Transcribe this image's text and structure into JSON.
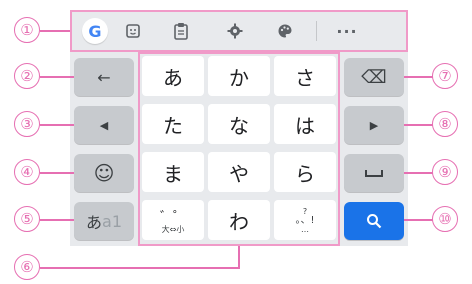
{
  "toolbar": {
    "g_label": "G",
    "dots_label": "···",
    "items": [
      "google-logo",
      "emoji-sticker",
      "clipboard",
      "settings",
      "theme",
      "more"
    ]
  },
  "left_keys": {
    "back_arrow": "←",
    "left_arrow": "◀",
    "emoji": "☺",
    "mode_label_a": "あ",
    "mode_label_b": "a1"
  },
  "right_keys": {
    "backspace": "⌫",
    "right_arrow": "▶",
    "space": "␣",
    "search": "🔍"
  },
  "grid": {
    "row1": [
      "あ",
      "か",
      "さ"
    ],
    "row2": [
      "た",
      "な",
      "は"
    ],
    "row3": [
      "ま",
      "や",
      "ら"
    ],
    "row4_mid": "わ",
    "dakuten_top": "゛゜",
    "dakuten_bottom": "大⇔小",
    "punct_top": "?",
    "punct_mid": "。、!",
    "punct_bottom": "…"
  },
  "callouts": [
    "①",
    "②",
    "③",
    "④",
    "⑤",
    "⑥",
    "⑦",
    "⑧",
    "⑨",
    "⑩"
  ],
  "colors": {
    "callout": "#e66fb2",
    "search_key": "#1a73e8"
  }
}
